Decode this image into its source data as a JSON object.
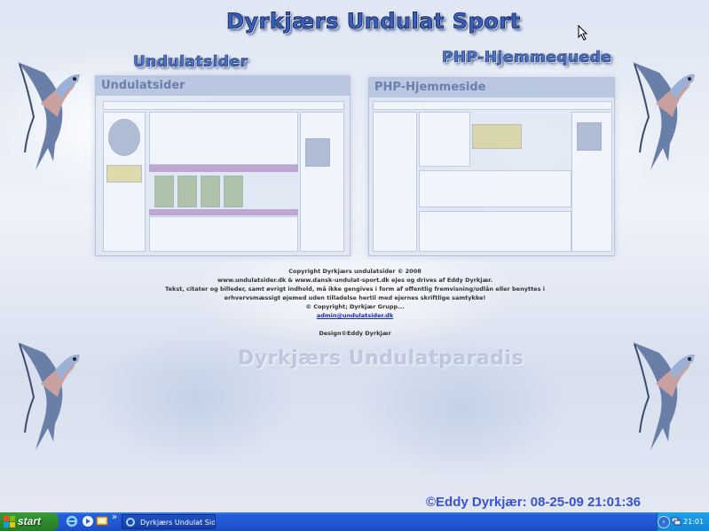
{
  "page": {
    "site_title": "Dyrkjærs Undulat Sport",
    "left_section_title": "Undulatsider",
    "right_section_title": "PHP-Hjemmequede",
    "left_thumb_title": "Undulatsider",
    "right_thumb_title": "PHP-Hjemmeside",
    "watermark": "Dyrkjærs Undulatparadis"
  },
  "copyright": {
    "line1": "Copyright Dyrkjærs undulatsider © 2008",
    "line2": "www.undulatsider.dk & www.dansk-undulat-sport.dk ejes og drives af Eddy Dyrkjær.",
    "line3": "Tekst, citater og billeder, samt øvrigt indhold, må ikke gengives i form af offentlig fremvisning/udlån eller benyttes i",
    "line4": "erhvervsmæssigt øjemed uden tilladelse hertil med ejernes skriftlige samtykke!",
    "line5": "© Copyright; Dyrkjær Grupp...",
    "email": "admin@undulatsider.dk",
    "design": "Design©Eddy Dyrkjær"
  },
  "stamp": "©Eddy Dyrkjær: 08-25-09 21:01:36",
  "taskbar": {
    "start_label": "start",
    "chevrons": "»",
    "task_label": "Dyrkjærs Undulat Sid...",
    "tray_arrow": "‹",
    "clock": "21:01"
  },
  "colors": {
    "taskbar_blue": "#245edb",
    "start_green": "#2e8f2e",
    "stamp_blue": "#3a52d8",
    "title_blue": "#3a5fb8"
  },
  "icons": [
    "windows-flag-icon",
    "internet-explorer-icon",
    "media-player-icon",
    "show-desktop-icon",
    "browser-task-icon",
    "network-tray-icon",
    "mouse-cursor-icon",
    "bird-icon"
  ]
}
